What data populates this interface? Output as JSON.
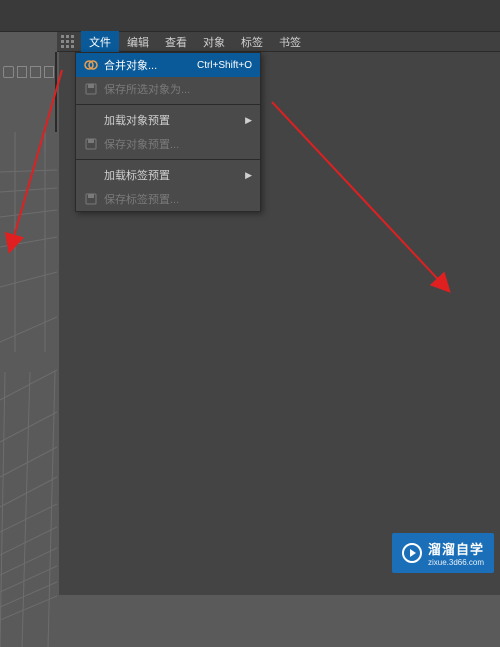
{
  "menubar": {
    "items": [
      {
        "label": "文件"
      },
      {
        "label": "编辑"
      },
      {
        "label": "查看"
      },
      {
        "label": "对象"
      },
      {
        "label": "标签"
      },
      {
        "label": "书签"
      }
    ]
  },
  "dropdown": {
    "items": [
      {
        "label": "合并对象...",
        "shortcut": "Ctrl+Shift+O",
        "highlighted": true,
        "icon": "merge"
      },
      {
        "label": "保存所选对象为...",
        "disabled": true,
        "icon": "save"
      },
      {
        "separator": true
      },
      {
        "label": "加载对象预置",
        "submenu": true
      },
      {
        "label": "保存对象预置...",
        "disabled": true,
        "icon": "save"
      },
      {
        "separator": true
      },
      {
        "label": "加载标签预置",
        "submenu": true
      },
      {
        "label": "保存标签预置...",
        "disabled": true,
        "icon": "save"
      }
    ]
  },
  "watermark": {
    "title": "溜溜自学",
    "url": "zixue.3d66.com"
  }
}
